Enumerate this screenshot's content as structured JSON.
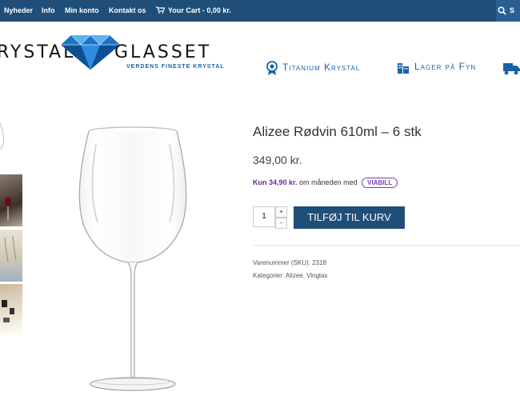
{
  "topbar": {
    "nav": [
      "Nyheder",
      "Info",
      "Min konto",
      "Kontakt os"
    ],
    "cart": "Your Cart - 0,00 kr.",
    "search_label": "S"
  },
  "logo": {
    "left_text": "RYSTAL",
    "right_text": "GLASSET",
    "tagline": "VERDENS FINESTE KRYSTAL"
  },
  "features": [
    "Titanium Krystal",
    "Lager på Fyn"
  ],
  "product": {
    "title": "Alizee Rødvin 610ml – 6 stk",
    "price": "349,00 kr.",
    "viabill_amount": "Kun 34,90 kr.",
    "viabill_text": "om måneden med",
    "viabill_badge": "VIABILL",
    "quantity": "1",
    "plus": "+",
    "minus": "-",
    "add_to_cart": "TILFØJ TIL KURV",
    "sku_label": "Varenummer (SKU):",
    "sku": "2318",
    "categories_label": "Kategorier:",
    "cat1": "Alizee",
    "cat_sep": ", ",
    "cat2": "Vinglas"
  },
  "colors": {
    "topbar": "#1f4e79",
    "button": "#1f4e79",
    "accent": "#1a62a8",
    "viabill": "#7a3fb0"
  }
}
